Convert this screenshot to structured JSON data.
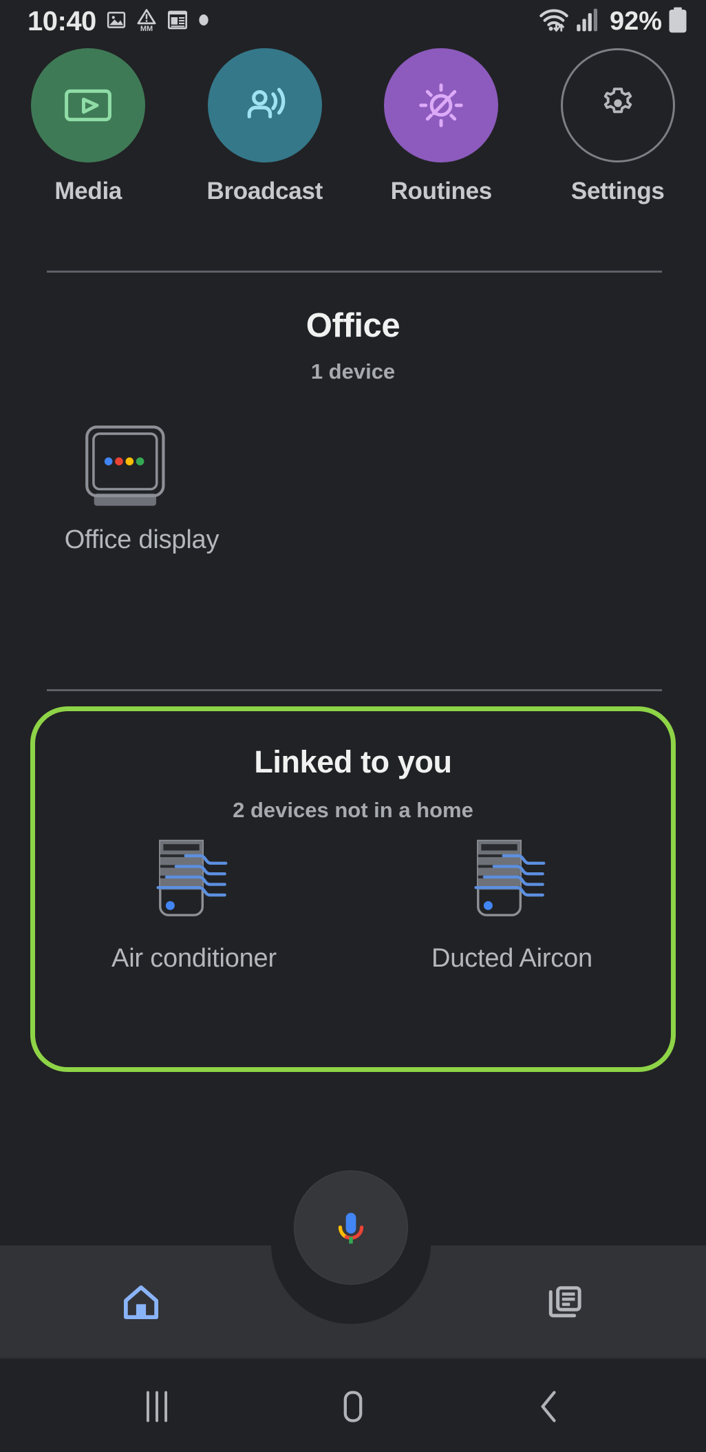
{
  "status_bar": {
    "time": "10:40",
    "left_icons": [
      "image-icon",
      "android-auto-mm-icon",
      "notepad-icon",
      "dot-icon"
    ],
    "right_icons": [
      "wifi-icon",
      "cellular-signal-icon"
    ],
    "battery_percent": "92%",
    "battery_icon": "battery-full-icon"
  },
  "quick_actions": [
    {
      "label": "Media",
      "icon": "media-play-icon",
      "color": "#3f7a56",
      "icon_color": "#8fdca7"
    },
    {
      "label": "Broadcast",
      "icon": "broadcast-icon",
      "color": "#35788a",
      "icon_color": "#8fdcec"
    },
    {
      "label": "Routines",
      "icon": "routines-sun-icon",
      "color": "#8c5bbd",
      "icon_color": "#dcaaf7"
    },
    {
      "label": "Settings",
      "icon": "gear-icon",
      "color": "transparent",
      "icon_color": "#b4b7bb"
    }
  ],
  "home_section": {
    "title": "Office",
    "subtitle": "1 device",
    "devices": [
      {
        "label": "Office display",
        "icon": "nest-hub-display-icon"
      }
    ]
  },
  "linked_section": {
    "title": "Linked to you",
    "subtitle": "2 devices not in a home",
    "highlight_color": "#8ed447",
    "devices": [
      {
        "label": "Air conditioner",
        "icon": "air-conditioner-icon"
      },
      {
        "label": "Ducted Aircon",
        "icon": "air-conditioner-icon"
      }
    ]
  },
  "assistant": {
    "icon": "google-assistant-mic-icon"
  },
  "bottom_nav": {
    "items": [
      {
        "name": "home",
        "icon": "home-icon",
        "selected": true,
        "color": "#8ab4f8"
      },
      {
        "name": "feed",
        "icon": "feed-icon",
        "selected": false,
        "color": "#b4b7bb"
      }
    ]
  },
  "system_nav": {
    "recents": "recents-icon",
    "home": "home-pill-icon",
    "back": "back-chevron-icon"
  },
  "colors": {
    "background": "#212225",
    "nav_background": "#323337",
    "divider": "#5d6066",
    "text_primary": "#f1f1f1",
    "text_secondary": "#a7aaae",
    "google_blue": "#4285f4",
    "google_red": "#ea4335",
    "google_yellow": "#fbbc05",
    "google_green": "#34a853"
  }
}
